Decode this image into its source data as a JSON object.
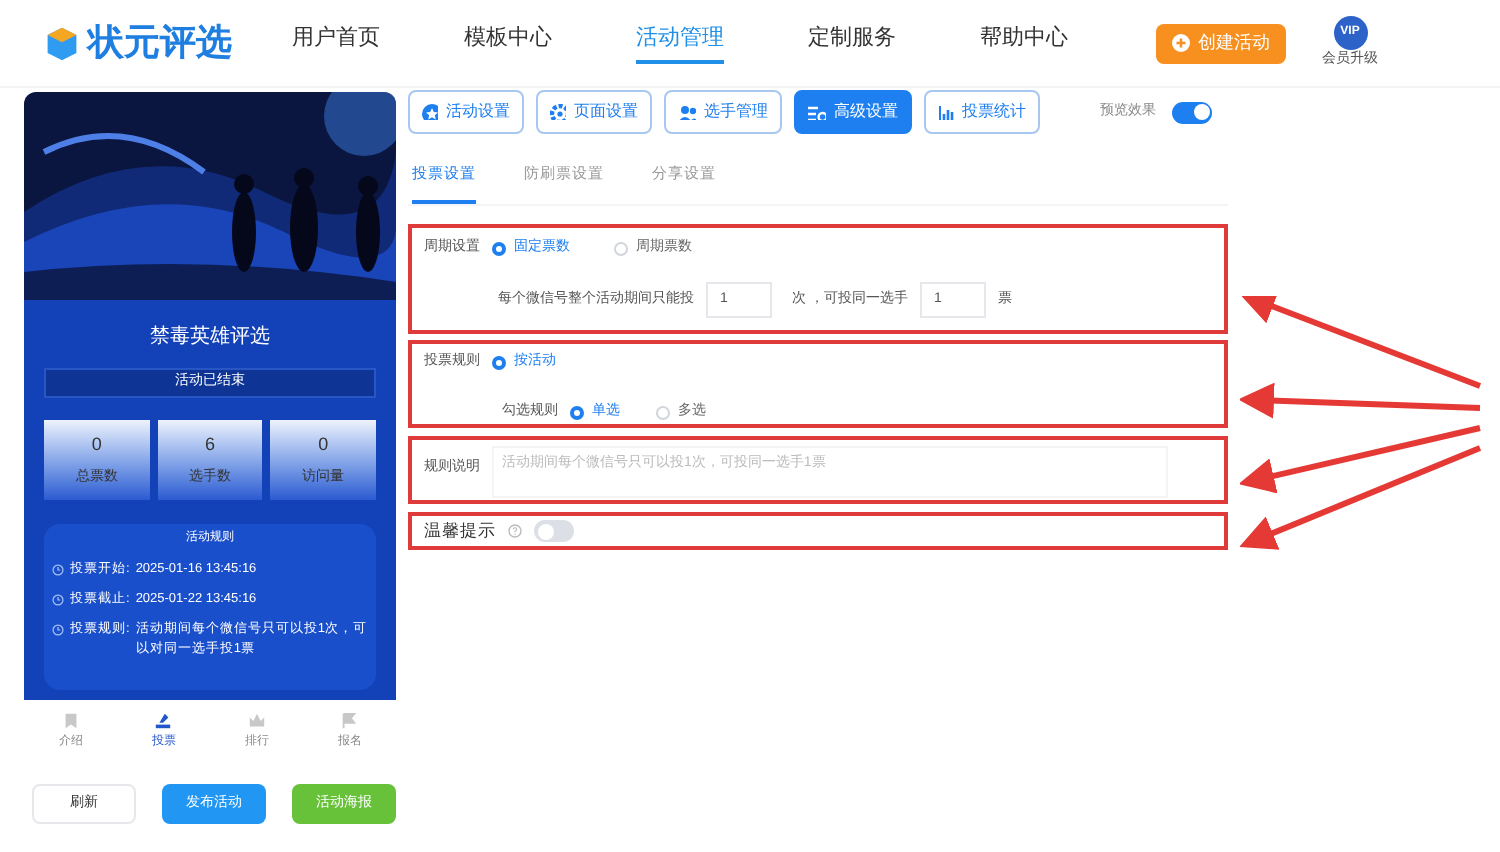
{
  "header": {
    "logo": "状元评选",
    "nav": [
      {
        "label": "用户首页",
        "selected": false
      },
      {
        "label": "模板中心",
        "selected": false
      },
      {
        "label": "活动管理",
        "selected": true
      },
      {
        "label": "定制服务",
        "selected": false
      },
      {
        "label": "帮助中心",
        "selected": false
      }
    ],
    "create_button": "创建活动",
    "vip_badge": "VIP",
    "vip_label": "会员升级"
  },
  "preview": {
    "title": "禁毒英雄评选",
    "status": "活动已结束",
    "stats": [
      {
        "value": "0",
        "label": "总票数"
      },
      {
        "value": "6",
        "label": "选手数"
      },
      {
        "value": "0",
        "label": "访问量"
      }
    ],
    "rules_title": "活动规则",
    "rules": [
      {
        "label": "投票开始:",
        "text": "2025-01-16 13:45:16"
      },
      {
        "label": "投票截止:",
        "text": "2025-01-22 13:45:16"
      },
      {
        "label": "投票规则:",
        "text": "活动期间每个微信号只可以投1次，可以对同一选手投1票"
      }
    ],
    "bottom_nav": [
      {
        "label": "介绍",
        "selected": false
      },
      {
        "label": "投票",
        "selected": true
      },
      {
        "label": "排行",
        "selected": false
      },
      {
        "label": "报名",
        "selected": false
      }
    ],
    "buttons": [
      {
        "label": "刷新",
        "kind": "plain"
      },
      {
        "label": "发布活动",
        "kind": "primary"
      },
      {
        "label": "活动海报",
        "kind": "success"
      }
    ]
  },
  "toolbar": [
    {
      "label": "活动设置",
      "selected": false
    },
    {
      "label": "页面设置",
      "selected": false
    },
    {
      "label": "选手管理",
      "selected": false
    },
    {
      "label": "高级设置",
      "selected": true
    },
    {
      "label": "投票统计",
      "selected": false
    }
  ],
  "preview_toggle": {
    "label": "预览效果",
    "on": true
  },
  "subtabs": [
    {
      "label": "投票设置",
      "selected": true
    },
    {
      "label": "防刷票设置",
      "selected": false
    },
    {
      "label": "分享设置",
      "selected": false
    }
  ],
  "period": {
    "label": "周期设置",
    "options": [
      {
        "label": "固定票数",
        "selected": true
      },
      {
        "label": "周期票数",
        "selected": false
      }
    ],
    "text_1": "每个微信号整个活动期间只能投",
    "votes": "1",
    "text_2": "次 ，可投同一选手",
    "per_player": "1",
    "text_3": "票"
  },
  "vote_rule": {
    "label": "投票规则",
    "options": [
      {
        "label": "按活动",
        "selected": true
      }
    ],
    "choice_label": "勾选规则",
    "choices": [
      {
        "label": "单选",
        "selected": true
      },
      {
        "label": "多选",
        "selected": false
      }
    ]
  },
  "rule_desc": {
    "label": "规则说明",
    "placeholder": "活动期间每个微信号只可以投1次，可投同一选手1票"
  },
  "tips": {
    "label": "温馨提示",
    "on": false
  }
}
